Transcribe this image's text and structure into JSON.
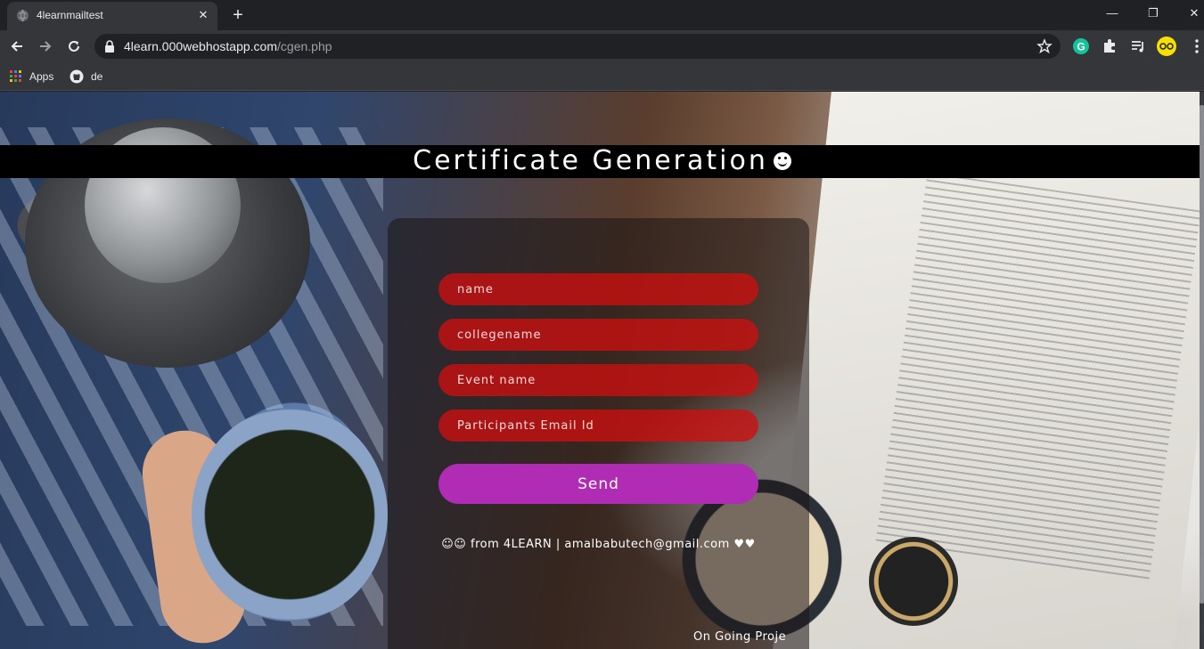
{
  "browser": {
    "tab_title": "4learnmailtest",
    "tab_close": "✕",
    "new_tab": "+",
    "url_host": "4learn.000webhostapp.com",
    "url_path": "/cgen.php",
    "window_controls": {
      "minimize": "—",
      "restore": "❐",
      "close": "✕"
    },
    "bookmarks": [
      {
        "label": "Apps",
        "icon": "apps-grid-icon"
      },
      {
        "label": "de",
        "icon": "github-icon"
      }
    ],
    "extensions": [
      "grammarly-icon",
      "extensions-puzzle-icon",
      "media-control-icon",
      "profile-avatar-icon"
    ]
  },
  "page": {
    "title": "Certificate Generation",
    "form": {
      "name_placeholder": "name",
      "college_placeholder": "collegename",
      "event_placeholder": "Event name",
      "email_placeholder": "Participants Email Id",
      "send_label": "Send"
    },
    "footer": "☺☺ from 4LEARN | amalbabutech@gmail.com ♥♥",
    "ongoing": "On Going Proje"
  },
  "colors": {
    "field_red": "#cd0f0f",
    "send_purple": "#b02cb4",
    "title_band": "#000000"
  }
}
